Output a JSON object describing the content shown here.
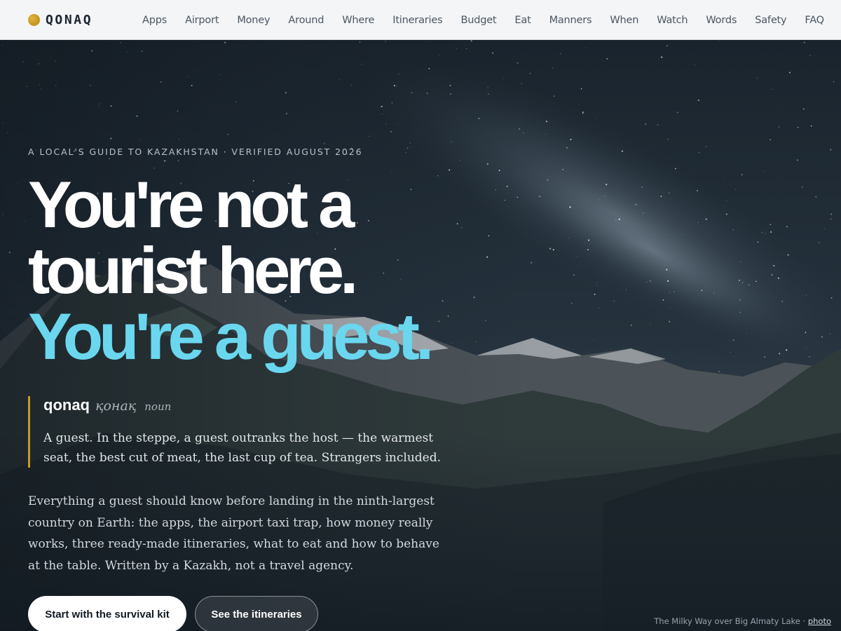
{
  "brand": {
    "name": "QONAQ",
    "dot_color": "#c9972b"
  },
  "nav": {
    "items": [
      "Apps",
      "Airport",
      "Money",
      "Around",
      "Where",
      "Itineraries",
      "Budget",
      "Eat",
      "Manners",
      "When",
      "Watch",
      "Words",
      "Safety",
      "FAQ"
    ]
  },
  "hero": {
    "kicker": "A LOCAL'S GUIDE TO KAZAKHSTAN · VERIFIED AUGUST 2026",
    "headline": {
      "line1": "You're not a",
      "line2": "tourist here.",
      "line3": "You're a guest.",
      "accent_color": "#6ad7ef"
    },
    "definition": {
      "word": "qonaq",
      "cyrillic": "қонақ",
      "part_of_speech": "noun",
      "text": "A guest. In the steppe, a guest outranks the host — the warmest seat, the best cut of meat, the last cup of tea. Strangers included.",
      "rule_color": "#c9972b"
    },
    "intro": "Everything a guest should know before landing in the ninth-largest country on Earth: the apps, the airport taxi trap, how money really works, three ready-made itineraries, what to eat and how to behave at the table. Written by a Kazakh, not a travel agency.",
    "buttons": {
      "primary": "Start with the survival kit",
      "secondary": "See the itineraries"
    },
    "caption": {
      "text": "The Milky Way over Big Almaty Lake · ",
      "link": "photo"
    }
  }
}
